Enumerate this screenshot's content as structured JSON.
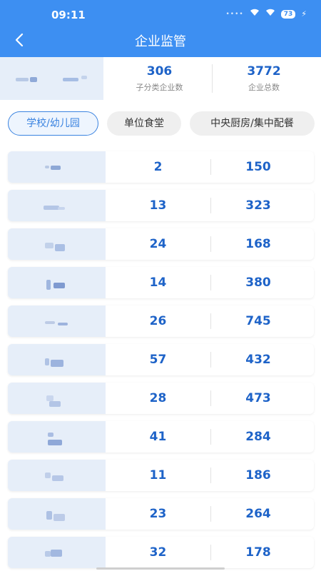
{
  "status_bar": {
    "time": "09:11",
    "battery": "73"
  },
  "header": {
    "title": "企业监管"
  },
  "summary": {
    "subcategory_count": "306",
    "subcategory_label": "子分类企业数",
    "total_count": "3772",
    "total_label": "企业总数"
  },
  "tabs": [
    {
      "label": "学校/幼儿园",
      "active": true
    },
    {
      "label": "单位食堂",
      "active": false
    },
    {
      "label": "中央厨房/集中配餐",
      "active": false
    }
  ],
  "rows": [
    {
      "value1": "2",
      "value2": "150"
    },
    {
      "value1": "13",
      "value2": "323"
    },
    {
      "value1": "24",
      "value2": "168"
    },
    {
      "value1": "14",
      "value2": "380"
    },
    {
      "value1": "26",
      "value2": "745"
    },
    {
      "value1": "57",
      "value2": "432"
    },
    {
      "value1": "28",
      "value2": "473"
    },
    {
      "value1": "41",
      "value2": "284"
    },
    {
      "value1": "11",
      "value2": "186"
    },
    {
      "value1": "23",
      "value2": "264"
    },
    {
      "value1": "32",
      "value2": "178"
    }
  ],
  "colors": {
    "primary": "#3d8ff2",
    "value_blue": "#1e63c8",
    "thumb_bg": "#e6eef9"
  }
}
